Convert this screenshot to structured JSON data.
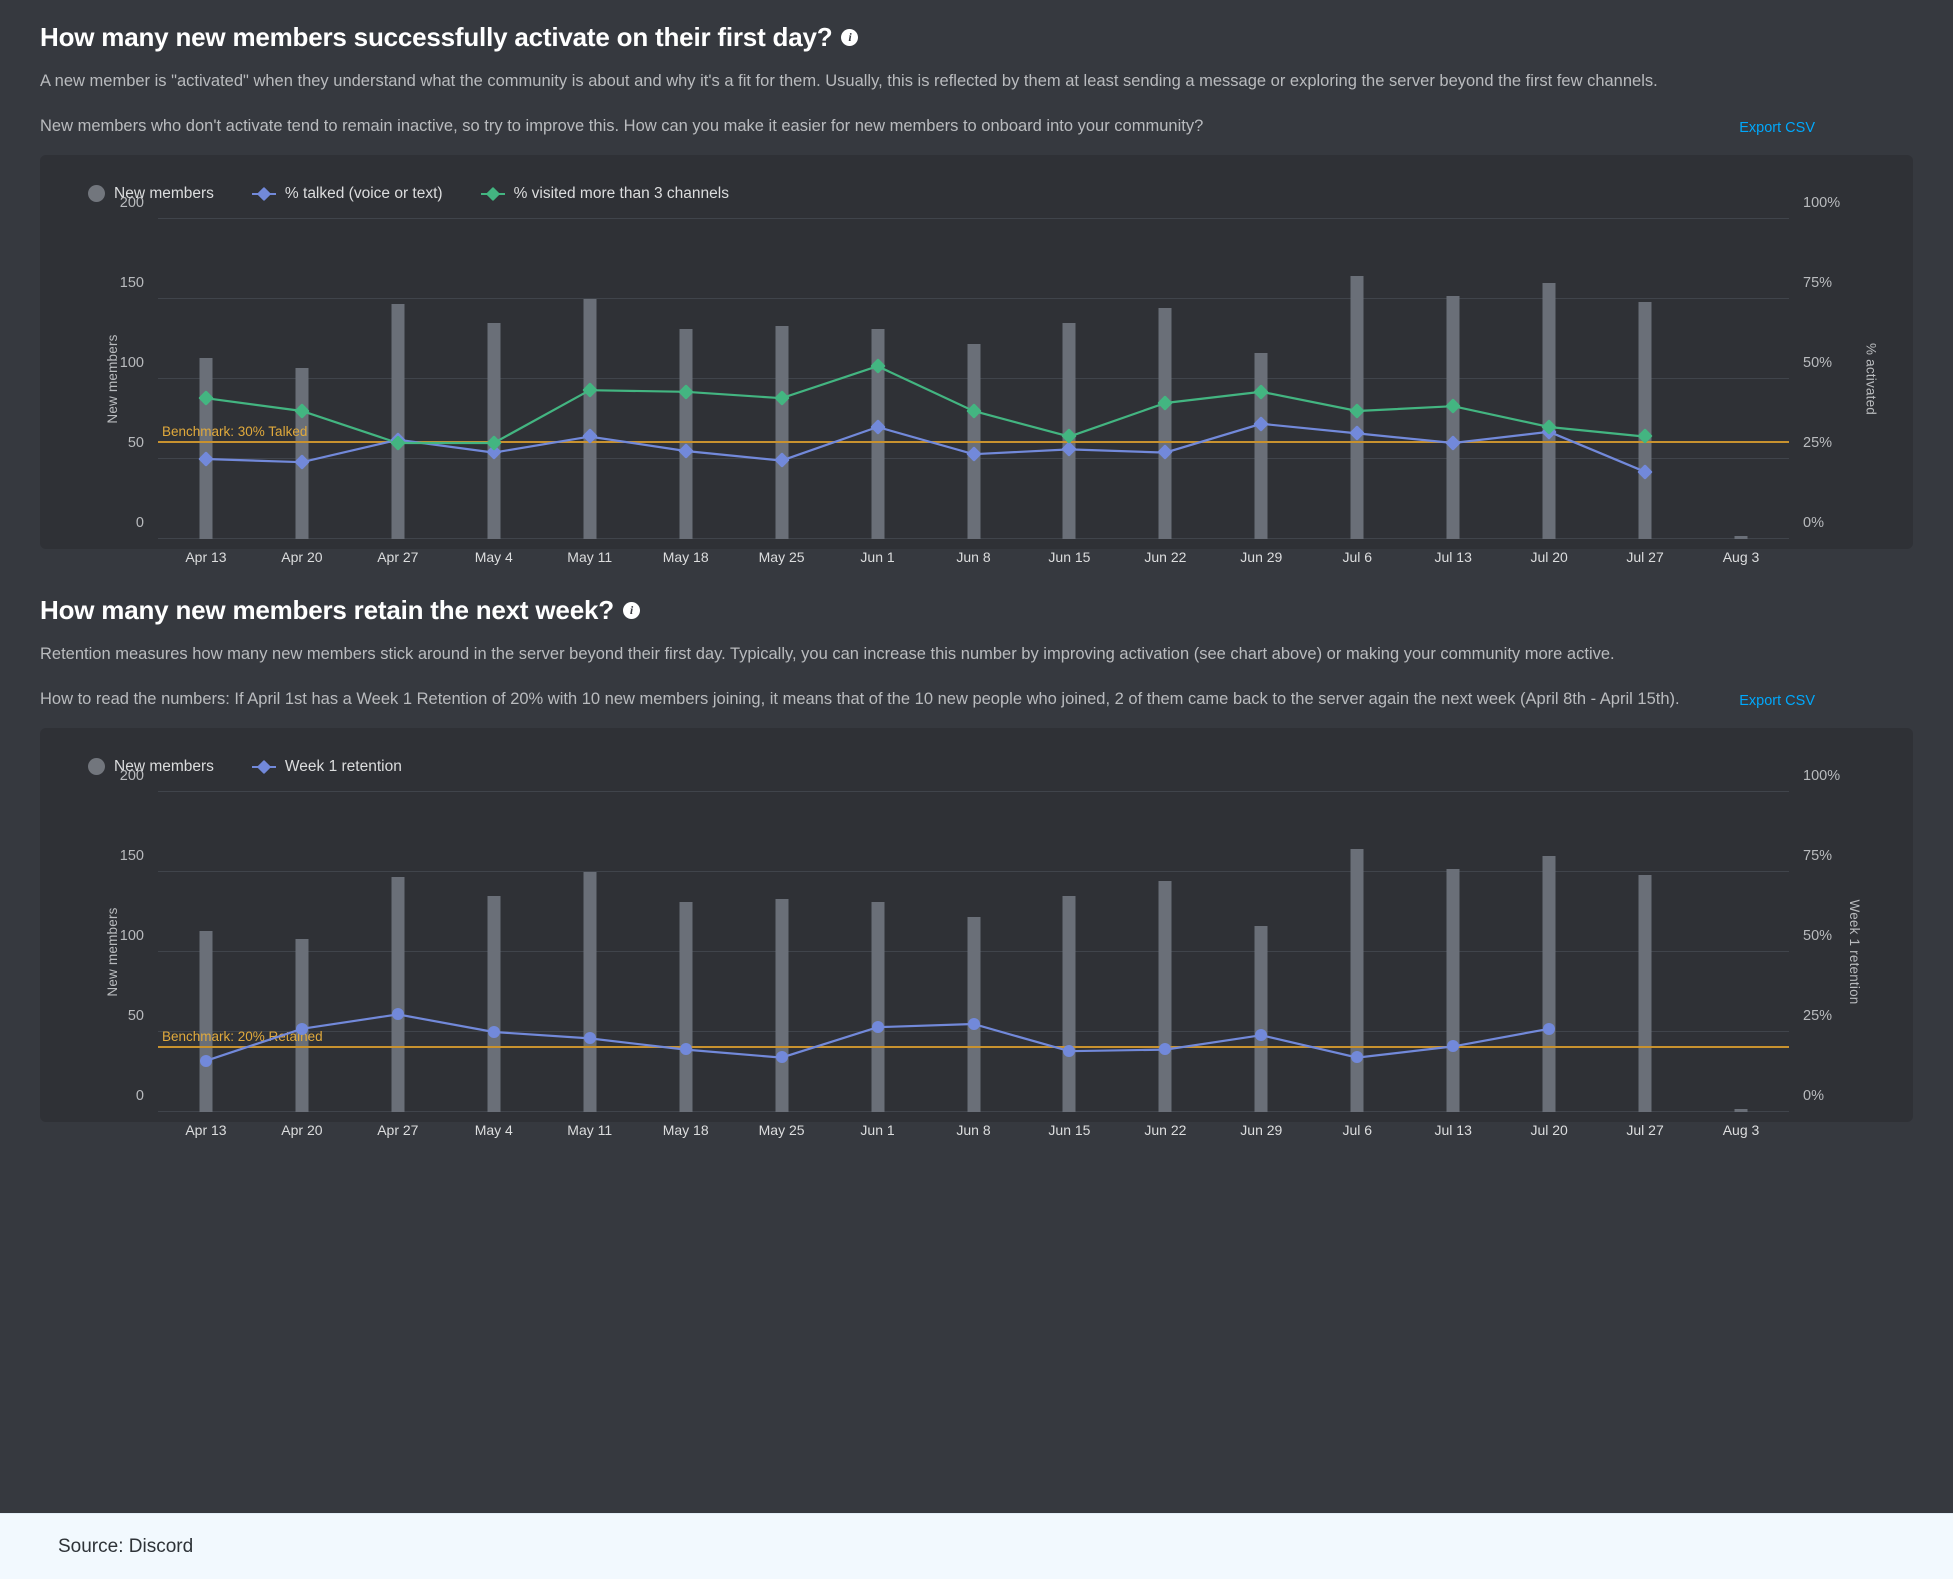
{
  "theme": {
    "page_bg": "#36393f",
    "card_bg": "#2f3136",
    "bar_color": "#6a6f78",
    "talked_color": "#7289da",
    "visited_color": "#43b581",
    "retention_color": "#7289da",
    "benchmark_color": "#c8922f",
    "link_color": "#00a8fc",
    "footer_bg": "#f2f9fe"
  },
  "sections": [
    {
      "title": "How many new members successfully activate on their first day?",
      "info_icon": "info-icon",
      "desc1": "A new member is \"activated\" when they understand what the community is about and why it's a fit for them. Usually, this is reflected by them at least sending a message or exploring the server beyond the first few channels.",
      "desc2": "New members who don't activate tend to remain inactive, so try to improve this. How can you make it easier for new members to onboard into your community?",
      "export_label": "Export CSV"
    },
    {
      "title": "How many new members retain the next week?",
      "info_icon": "info-icon",
      "desc1": "Retention measures how many new members stick around in the server beyond their first day. Typically, you can increase this number by improving activation (see chart above) or making your community more active.",
      "desc2": "How to read the numbers: If April 1st has a Week 1 Retention of 20% with 10 new members joining, it means that of the 10 new people who joined, 2 of them came back to the server again the next week (April 8th - April 15th).",
      "export_label": "Export CSV"
    }
  ],
  "footer": {
    "source": "Source: Discord"
  },
  "chart_data": [
    {
      "type": "bar",
      "title": "How many new members successfully activate on their first day?",
      "categories": [
        "Apr 13",
        "Apr 20",
        "Apr 27",
        "May 4",
        "May 11",
        "May 18",
        "May 25",
        "Jun 1",
        "Jun 8",
        "Jun 15",
        "Jun 22",
        "Jun 29",
        "Jul 6",
        "Jul 13",
        "Jul 20",
        "Jul 27",
        "Aug 3"
      ],
      "ylabel": "New members",
      "y2label": "% activated",
      "ylim": [
        0,
        200
      ],
      "y2lim": [
        0,
        100
      ],
      "yticks": [
        "0",
        "50",
        "100",
        "150",
        "200"
      ],
      "y2ticks": [
        "0%",
        "25%",
        "50%",
        "75%",
        "100%"
      ],
      "grid": true,
      "legend_position": "top-left",
      "legend": [
        "New members",
        "% talked (voice or text)",
        "% visited more than 3 channels"
      ],
      "benchmark": {
        "label": "Benchmark: 30% Talked",
        "value": 30
      },
      "series": [
        {
          "name": "New members",
          "type": "bar",
          "axis": "left",
          "values": [
            113,
            107,
            147,
            135,
            150,
            131,
            133,
            131,
            122,
            135,
            144,
            116,
            164,
            152,
            160,
            148,
            2
          ]
        },
        {
          "name": "% talked (voice or text)",
          "type": "line",
          "axis": "right",
          "color": "#7289da",
          "values": [
            25,
            24,
            31,
            27,
            32,
            27.5,
            24.5,
            35,
            26.5,
            28,
            27,
            36,
            33,
            30,
            33.5,
            21,
            null
          ]
        },
        {
          "name": "% visited more than 3 channels",
          "type": "line",
          "axis": "right",
          "color": "#43b581",
          "values": [
            44,
            40,
            30,
            30,
            46.5,
            46,
            44,
            54,
            40,
            32,
            42.5,
            46,
            40,
            41.5,
            35,
            32,
            null
          ]
        }
      ]
    },
    {
      "type": "bar",
      "title": "How many new members retain the next week?",
      "categories": [
        "Apr 13",
        "Apr 20",
        "Apr 27",
        "May 4",
        "May 11",
        "May 18",
        "May 25",
        "Jun 1",
        "Jun 8",
        "Jun 15",
        "Jun 22",
        "Jun 29",
        "Jul 6",
        "Jul 13",
        "Jul 20",
        "Jul 27",
        "Aug 3"
      ],
      "ylabel": "New members",
      "y2label": "Week 1 retention",
      "ylim": [
        0,
        200
      ],
      "y2lim": [
        0,
        100
      ],
      "yticks": [
        "0",
        "50",
        "100",
        "150",
        "200"
      ],
      "y2ticks": [
        "0%",
        "25%",
        "50%",
        "75%",
        "100%"
      ],
      "grid": true,
      "legend_position": "top-left",
      "legend": [
        "New members",
        "Week 1 retention"
      ],
      "benchmark": {
        "label": "Benchmark: 20% Retained",
        "value": 20
      },
      "series": [
        {
          "name": "New members",
          "type": "bar",
          "axis": "left",
          "values": [
            113,
            108,
            147,
            135,
            150,
            131,
            133,
            131,
            122,
            135,
            144,
            116,
            164,
            152,
            160,
            148,
            2
          ]
        },
        {
          "name": "Week 1 retention",
          "type": "line",
          "axis": "right",
          "color": "#7289da",
          "values": [
            16,
            26,
            30.5,
            25,
            23,
            19.5,
            17,
            26.5,
            27.5,
            19,
            19.5,
            24,
            17,
            20.5,
            26,
            null,
            null
          ]
        }
      ]
    }
  ]
}
